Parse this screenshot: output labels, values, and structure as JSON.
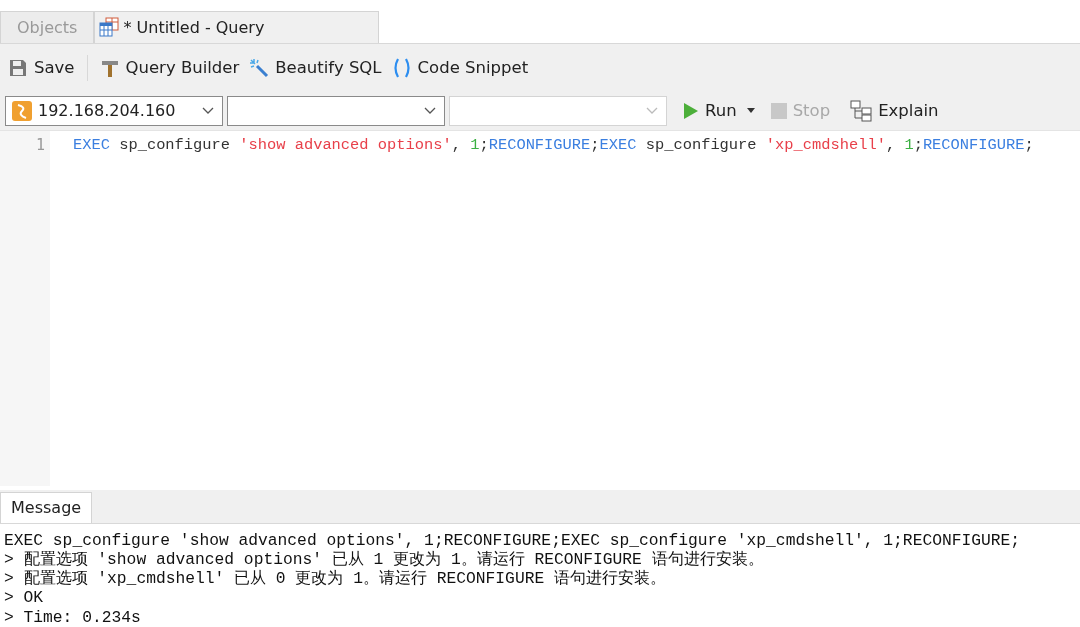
{
  "tabs": [
    {
      "label": "Objects",
      "selected": false,
      "kind": "plain"
    },
    {
      "label": "* Untitled - Query",
      "selected": true,
      "kind": "query"
    }
  ],
  "toolbar": [
    {
      "label": "Save",
      "kind": "save"
    },
    {
      "label": "Query Builder",
      "kind": "builder"
    },
    {
      "label": "Beautify SQL",
      "kind": "beautify"
    },
    {
      "label": "Code Snippet",
      "kind": "snippet"
    }
  ],
  "selectors": [
    {
      "value": "192.168.204.160",
      "kind": "connection",
      "disabled": false
    },
    {
      "kind": "database",
      "disabled": false
    },
    {
      "kind": "schema",
      "disabled": true
    }
  ],
  "actions": [
    {
      "label": "Run",
      "kind": "run",
      "disabled": false
    },
    {
      "label": "Stop",
      "kind": "stop",
      "disabled": true
    },
    {
      "label": "Explain",
      "kind": "explain",
      "disabled": false
    }
  ],
  "editor": {
    "lines": [
      {
        "number": "1",
        "tokens": [
          {
            "text": "EXEC",
            "kind": "keyword"
          },
          {
            "text": " sp_configure ",
            "kind": "plain"
          },
          {
            "text": "'show advanced options'",
            "kind": "string"
          },
          {
            "text": ", ",
            "kind": "plain"
          },
          {
            "text": "1",
            "kind": "number"
          },
          {
            "text": ";",
            "kind": "plain"
          },
          {
            "text": "RECONFIGURE",
            "kind": "keyword"
          },
          {
            "text": ";",
            "kind": "plain"
          },
          {
            "text": "EXEC",
            "kind": "keyword"
          },
          {
            "text": " sp_configure ",
            "kind": "plain"
          },
          {
            "text": "'xp_cmdshell'",
            "kind": "string"
          },
          {
            "text": ", ",
            "kind": "plain"
          },
          {
            "text": "1",
            "kind": "number"
          },
          {
            "text": ";",
            "kind": "plain"
          },
          {
            "text": "RECONFIGURE",
            "kind": "keyword"
          },
          {
            "text": ";",
            "kind": "plain"
          }
        ]
      }
    ]
  },
  "message_tab": {
    "label": "Message",
    "selected": true
  },
  "messages": [
    "EXEC sp_configure 'show advanced options', 1;RECONFIGURE;EXEC sp_configure 'xp_cmdshell', 1;RECONFIGURE;",
    "> 配置选项 'show advanced options' 已从 1 更改为 1。请运行 RECONFIGURE 语句进行安装。",
    "> 配置选项 'xp_cmdshell' 已从 0 更改为 1。请运行 RECONFIGURE 语句进行安装。",
    "> OK",
    "> Time: 0.234s"
  ]
}
